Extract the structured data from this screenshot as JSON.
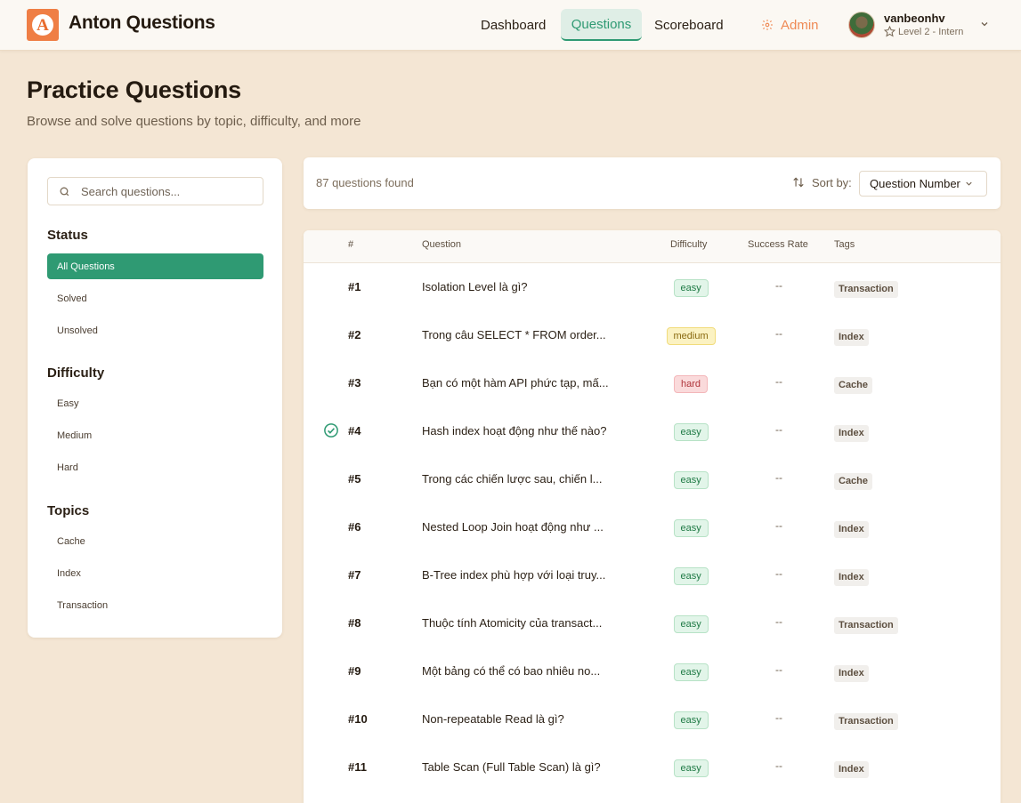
{
  "header": {
    "logo_letter": "A",
    "app_title": "Anton Questions",
    "nav": {
      "dashboard": "Dashboard",
      "questions": "Questions",
      "scoreboard": "Scoreboard",
      "admin": "Admin"
    },
    "user": {
      "name": "vanbeonhv",
      "level": "Level 2 - Intern"
    }
  },
  "page": {
    "title": "Practice Questions",
    "subtitle": "Browse and solve questions by topic, difficulty, and more"
  },
  "sidebar": {
    "search_placeholder": "Search questions...",
    "status_title": "Status",
    "status_items": [
      "All Questions",
      "Solved",
      "Unsolved"
    ],
    "difficulty_title": "Difficulty",
    "difficulty_items": [
      "Easy",
      "Medium",
      "Hard"
    ],
    "topics_title": "Topics",
    "topic_items": [
      "Cache",
      "Index",
      "Transaction"
    ]
  },
  "results": {
    "count_text": "87 questions found",
    "sort_label": "Sort by:",
    "sort_value": "Question Number"
  },
  "table": {
    "columns": [
      "#",
      "Question",
      "Difficulty",
      "Success Rate",
      "Tags"
    ],
    "rows": [
      {
        "num": "#1",
        "question": "Isolation Level là gì?",
        "difficulty": "easy",
        "rate": "--",
        "tag": "Transaction",
        "solved": false
      },
      {
        "num": "#2",
        "question": "Trong câu SELECT * FROM order...",
        "difficulty": "medium",
        "rate": "--",
        "tag": "Index",
        "solved": false
      },
      {
        "num": "#3",
        "question": "Bạn có một hàm API phức tạp, mấ...",
        "difficulty": "hard",
        "rate": "--",
        "tag": "Cache",
        "solved": false
      },
      {
        "num": "#4",
        "question": "Hash index hoạt động như thế nào?",
        "difficulty": "easy",
        "rate": "--",
        "tag": "Index",
        "solved": true
      },
      {
        "num": "#5",
        "question": "Trong các chiến lược sau, chiến l...",
        "difficulty": "easy",
        "rate": "--",
        "tag": "Cache",
        "solved": false
      },
      {
        "num": "#6",
        "question": "Nested Loop Join hoạt động như ...",
        "difficulty": "easy",
        "rate": "--",
        "tag": "Index",
        "solved": false
      },
      {
        "num": "#7",
        "question": "B-Tree index phù hợp với loại truy...",
        "difficulty": "easy",
        "rate": "--",
        "tag": "Index",
        "solved": false
      },
      {
        "num": "#8",
        "question": "Thuộc tính Atomicity của transact...",
        "difficulty": "easy",
        "rate": "--",
        "tag": "Transaction",
        "solved": false
      },
      {
        "num": "#9",
        "question": "Một bảng có thể có bao nhiêu no...",
        "difficulty": "easy",
        "rate": "--",
        "tag": "Index",
        "solved": false
      },
      {
        "num": "#10",
        "question": "Non-repeatable Read là gì?",
        "difficulty": "easy",
        "rate": "--",
        "tag": "Transaction",
        "solved": false
      },
      {
        "num": "#11",
        "question": "Table Scan (Full Table Scan) là gì?",
        "difficulty": "easy",
        "rate": "--",
        "tag": "Index",
        "solved": false
      }
    ]
  },
  "colors": {
    "accent_green": "#2f9a73",
    "brand_orange": "#ef7e45",
    "page_background": "#f4e6d4"
  },
  "icons": {
    "search": "search-icon",
    "sort": "sort-arrows-icon",
    "chevron": "chevron-down-icon",
    "admin": "gear-icon",
    "level": "star-icon",
    "solved": "check-circle-icon"
  }
}
